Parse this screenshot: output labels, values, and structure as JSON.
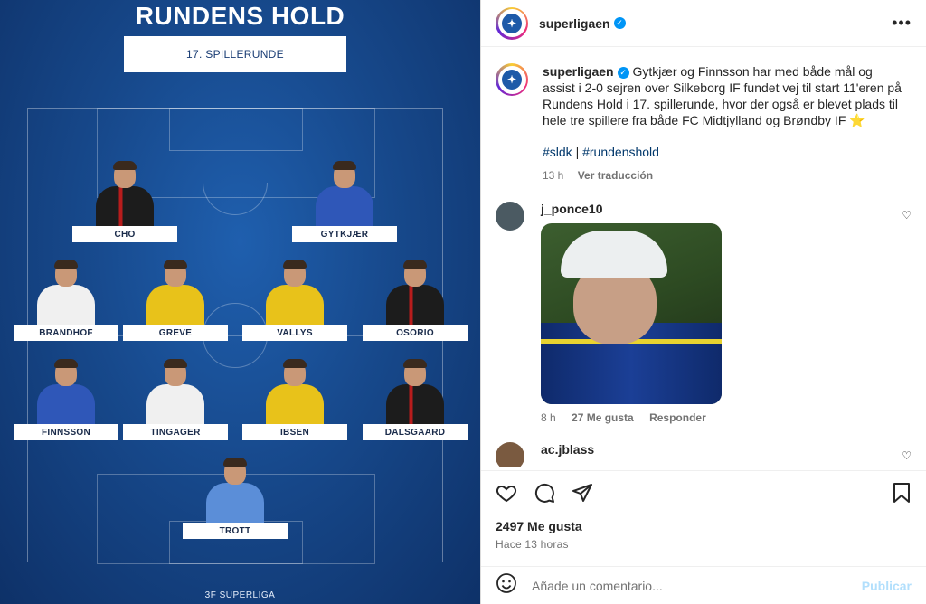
{
  "image": {
    "title": "RUNDENS HOLD",
    "round": "17. SPILLERUNDE",
    "brand": "3F SUPERLIGA",
    "players": [
      {
        "name": "CHO",
        "kit": "black"
      },
      {
        "name": "GYTKJÆR",
        "kit": "blue"
      },
      {
        "name": "BRANDHOF",
        "kit": "white"
      },
      {
        "name": "GREVE",
        "kit": "yellow"
      },
      {
        "name": "VALLYS",
        "kit": "yellow"
      },
      {
        "name": "OSORIO",
        "kit": "black"
      },
      {
        "name": "FINNSSON",
        "kit": "blue"
      },
      {
        "name": "TINGAGER",
        "kit": "white"
      },
      {
        "name": "IBSEN",
        "kit": "yellow"
      },
      {
        "name": "DALSGAARD",
        "kit": "black"
      },
      {
        "name": "TROTT",
        "kit": "lightblue"
      }
    ]
  },
  "header": {
    "username": "superligaen",
    "more_icon": "more-options-icon"
  },
  "caption": {
    "username": "superligaen",
    "text": "Gytkjær og Finnsson har med både mål og assist i 2-0 sejren over Silkeborg IF fundet vej til start 11'eren på Rundens Hold i 17. spillerunde, hvor der også er blevet plads til hele tre spillere fra både FC Midtjylland og Brøndby IF ⭐",
    "tag1": "#sldk",
    "separator": "|",
    "tag2": "#rundenshold",
    "time": "13 h",
    "translate": "Ver traducción"
  },
  "comments": [
    {
      "username": "j_ponce10",
      "time": "8 h",
      "likes": "27 Me gusta",
      "reply": "Responder"
    },
    {
      "username": "ac.jblass"
    }
  ],
  "footer": {
    "likes": "2497 Me gusta",
    "posted": "Hace 13 horas",
    "placeholder": "Añade un comentario...",
    "publish": "Publicar"
  },
  "colors": {
    "accent": "#0095f6",
    "panel_bg": "#17498c",
    "link": "#00376b"
  }
}
